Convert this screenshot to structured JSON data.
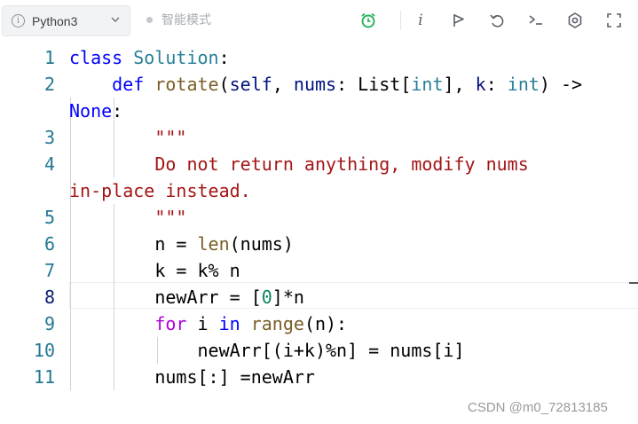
{
  "toolbar": {
    "language": "Python3",
    "mode_label": "智能模式",
    "icons": [
      "info-icon",
      "chevron-down-icon",
      "alarm-clock-icon",
      "italic-info-icon",
      "flag-icon",
      "undo-icon",
      "terminal-icon",
      "settings-icon",
      "fullscreen-icon"
    ],
    "alarm_icon_color": "#2db55d",
    "italic_glyph": "i"
  },
  "editor": {
    "active_line": 8,
    "line_numbers": [
      "1",
      "2",
      "",
      "3",
      "4",
      "",
      "5",
      "6",
      "7",
      "8",
      "9",
      "10",
      "11"
    ],
    "lines": [
      [
        {
          "t": "class",
          "c": "kw"
        },
        {
          "t": " ",
          "c": "plain"
        },
        {
          "t": "Solution",
          "c": "cls"
        },
        {
          "t": ":",
          "c": "plain"
        }
      ],
      [
        {
          "t": "    ",
          "c": "plain"
        },
        {
          "t": "def",
          "c": "kw"
        },
        {
          "t": " ",
          "c": "plain"
        },
        {
          "t": "rotate",
          "c": "fn"
        },
        {
          "t": "(",
          "c": "plain"
        },
        {
          "t": "self",
          "c": "prm"
        },
        {
          "t": ", ",
          "c": "plain"
        },
        {
          "t": "nums",
          "c": "prm"
        },
        {
          "t": ": ",
          "c": "plain"
        },
        {
          "t": "List",
          "c": "plain"
        },
        {
          "t": "[",
          "c": "plain"
        },
        {
          "t": "int",
          "c": "cls"
        },
        {
          "t": "], ",
          "c": "plain"
        },
        {
          "t": "k",
          "c": "prm"
        },
        {
          "t": ": ",
          "c": "plain"
        },
        {
          "t": "int",
          "c": "cls"
        },
        {
          "t": ") ->",
          "c": "plain"
        }
      ],
      [
        {
          "t": "None",
          "c": "kw"
        },
        {
          "t": ":",
          "c": "plain"
        }
      ],
      [
        {
          "t": "        ",
          "c": "plain"
        },
        {
          "t": "\"\"\"",
          "c": "str"
        }
      ],
      [
        {
          "t": "        ",
          "c": "plain"
        },
        {
          "t": "Do not return anything, modify nums",
          "c": "str"
        }
      ],
      [
        {
          "t": "in-place instead.",
          "c": "str"
        }
      ],
      [
        {
          "t": "        ",
          "c": "plain"
        },
        {
          "t": "\"\"\"",
          "c": "str"
        }
      ],
      [
        {
          "t": "        n = ",
          "c": "plain"
        },
        {
          "t": "len",
          "c": "fn"
        },
        {
          "t": "(nums)",
          "c": "plain"
        }
      ],
      [
        {
          "t": "        k = k% n",
          "c": "plain"
        }
      ],
      [
        {
          "t": "        newArr = [",
          "c": "plain"
        },
        {
          "t": "0",
          "c": "num"
        },
        {
          "t": "]*n",
          "c": "plain"
        }
      ],
      [
        {
          "t": "        ",
          "c": "plain"
        },
        {
          "t": "for",
          "c": "ctl"
        },
        {
          "t": " i ",
          "c": "plain"
        },
        {
          "t": "in",
          "c": "kw"
        },
        {
          "t": " ",
          "c": "plain"
        },
        {
          "t": "range",
          "c": "fn"
        },
        {
          "t": "(n):",
          "c": "plain"
        }
      ],
      [
        {
          "t": "            newArr[(i+k)%n] = nums[i]",
          "c": "plain"
        }
      ],
      [
        {
          "t": "        nums[:] =newArr",
          "c": "plain"
        }
      ]
    ]
  },
  "watermark": "CSDN @m0_72813185"
}
